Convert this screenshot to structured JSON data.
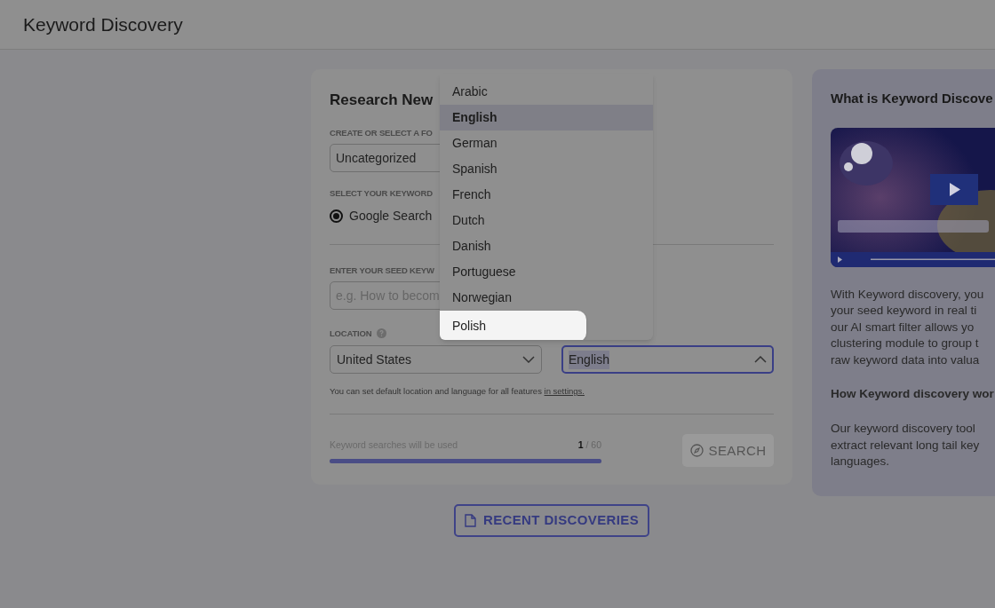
{
  "header": {
    "title": "Keyword Discovery"
  },
  "form": {
    "title": "Research New",
    "folder": {
      "label": "CREATE OR SELECT A FO",
      "value": "Uncategorized"
    },
    "source": {
      "label": "SELECT YOUR KEYWORD",
      "options": [
        {
          "label": "Google Search",
          "selected": true
        }
      ]
    },
    "seed": {
      "label": "ENTER YOUR SEED KEYW",
      "placeholder": "e.g. How to becom"
    },
    "location": {
      "label": "LOCATION",
      "value": "United States",
      "expanded": false
    },
    "language": {
      "value": "English",
      "expanded": true,
      "options": [
        {
          "label": "Arabic",
          "selected": false,
          "highlighted": false
        },
        {
          "label": "English",
          "selected": true,
          "highlighted": false
        },
        {
          "label": "German",
          "selected": false,
          "highlighted": false
        },
        {
          "label": "Spanish",
          "selected": false,
          "highlighted": false
        },
        {
          "label": "French",
          "selected": false,
          "highlighted": false
        },
        {
          "label": "Dutch",
          "selected": false,
          "highlighted": false
        },
        {
          "label": "Danish",
          "selected": false,
          "highlighted": false
        },
        {
          "label": "Portuguese",
          "selected": false,
          "highlighted": false
        },
        {
          "label": "Norwegian",
          "selected": false,
          "highlighted": false
        },
        {
          "label": "Polish",
          "selected": false,
          "highlighted": true
        }
      ]
    },
    "hint": "You can set default location and language for all features",
    "hint_link": "in settings.",
    "usage": {
      "label": "Keyword searches will be used",
      "used": "1",
      "total": "/ 60",
      "level": 1
    },
    "search_button": {
      "label": "SEARCH",
      "disabled": true
    }
  },
  "recent_button": "RECENT DISCOVERIES",
  "info": {
    "title": "What is Keyword Discove",
    "intro_lines": [
      "With Keyword discovery, you",
      "your seed keyword in real ti",
      "our AI smart filter allows yo",
      "clustering module to group t",
      "raw keyword data into valua"
    ],
    "subtitle": "How Keyword discovery wor",
    "body_lines": [
      "Our keyword discovery tool",
      "extract relevant long tail key",
      "languages."
    ]
  }
}
